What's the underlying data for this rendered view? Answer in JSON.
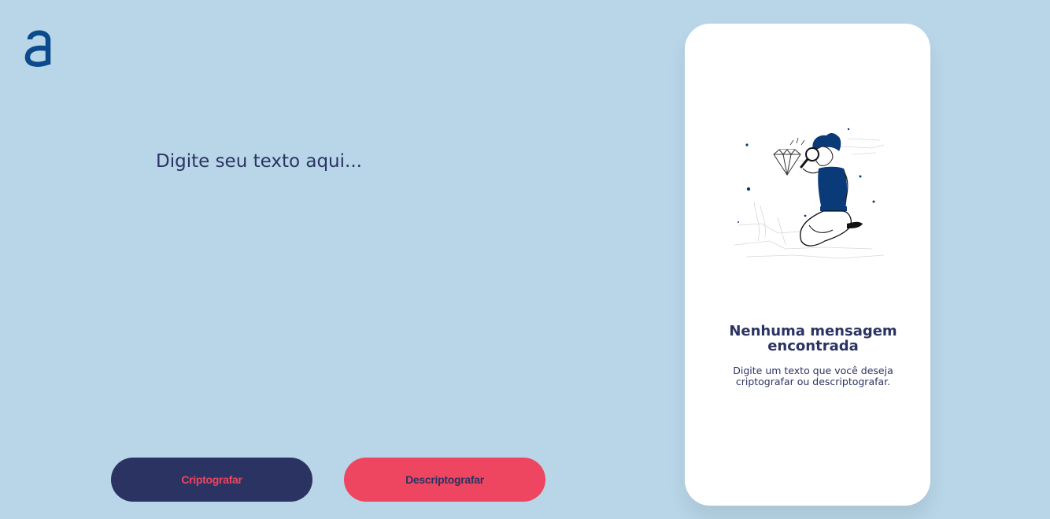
{
  "logo": {
    "icon": "alura-a-logo-icon",
    "color": "#0b4a8b",
    "glyph": "a"
  },
  "editor": {
    "placeholder": "Digite seu texto aqui...",
    "value": ""
  },
  "buttons": {
    "encrypt_label": "Criptografar",
    "decrypt_label": "Descriptografar"
  },
  "output_panel": {
    "illustration": "person-with-magnifying-glass-diamond-illustration",
    "title_line1": "Nenhuma mensagem",
    "title_line2": "encontrada",
    "text_line1": "Digite um texto que você deseja",
    "text_line2": "criptografar ou descriptografar."
  },
  "colors": {
    "background": "#b8d6e8",
    "primary_dark": "#2b3363",
    "accent_red": "#ee4560",
    "logo_blue": "#0b4a8b",
    "panel": "#ffffff"
  }
}
